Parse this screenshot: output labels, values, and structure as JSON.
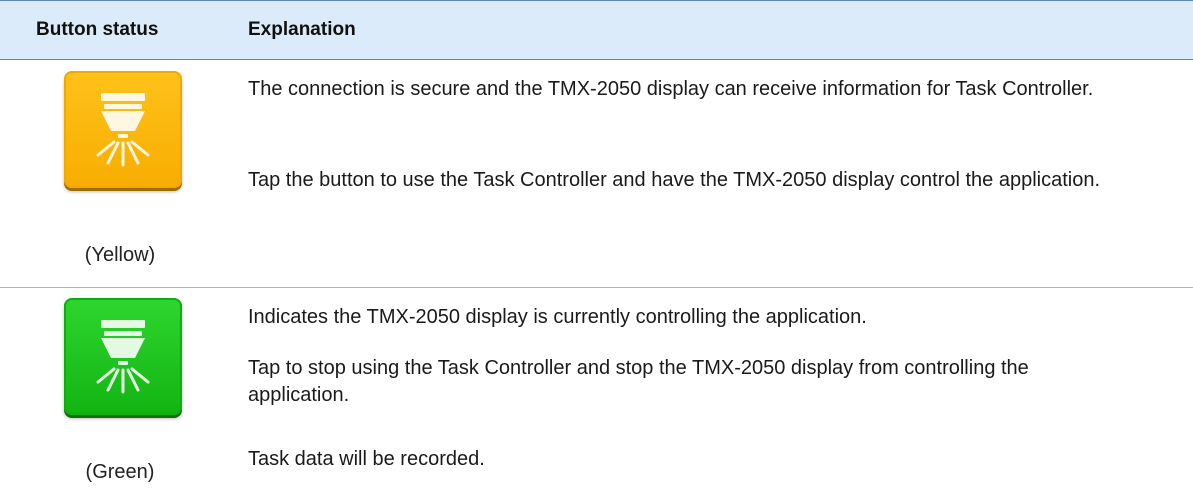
{
  "header": {
    "status_label": "Button status",
    "explanation_label": "Explanation"
  },
  "rows": [
    {
      "icon": "sprayer-nozzle-icon",
      "color": "#f7ad00",
      "caption": "(Yellow)",
      "paragraphs": [
        "The connection is secure and the TMX-2050 display can receive information for Task Controller.",
        "Tap the button to use the Task Controller and have the TMX-2050 display control the application."
      ]
    },
    {
      "icon": "sprayer-nozzle-icon",
      "color": "#12b412",
      "caption": "(Green)",
      "paragraphs": [
        "Indicates the TMX-2050 display is currently controlling the application.",
        "Tap to stop using the Task Controller and stop the TMX-2050 display from controlling the application.",
        "Task data will be recorded."
      ]
    }
  ]
}
